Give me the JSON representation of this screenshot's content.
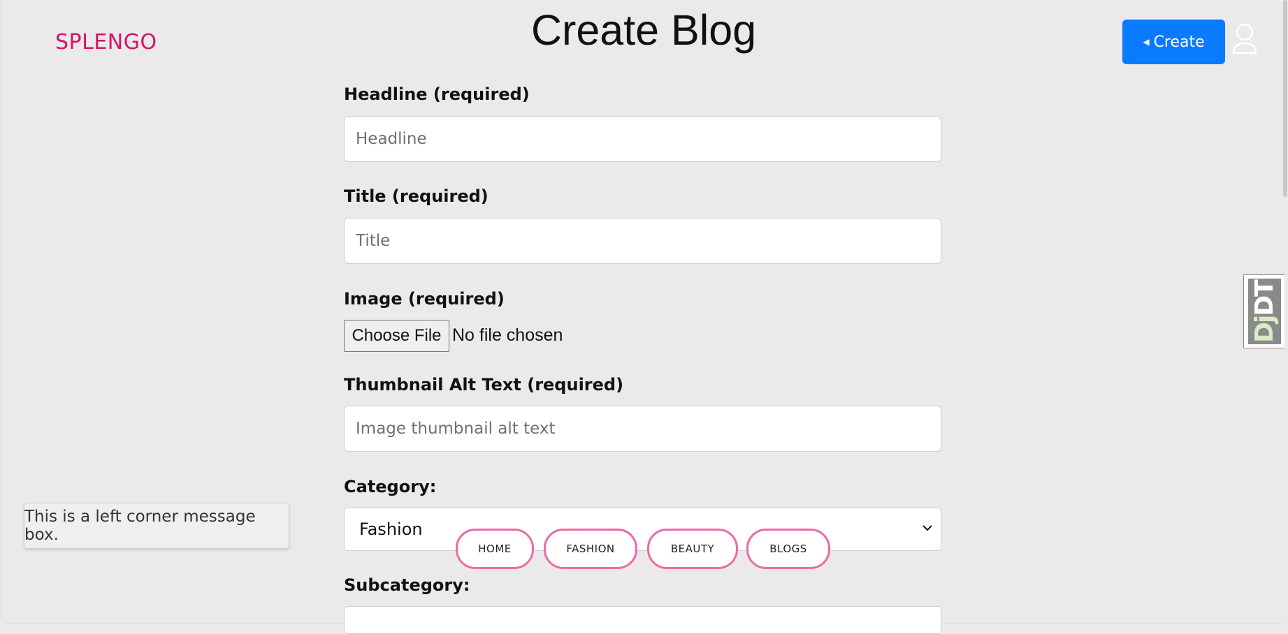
{
  "header": {
    "brand": "SPLENGO",
    "title": "Create Blog",
    "create_label": "Create",
    "avatar_icon": "user-icon"
  },
  "form": {
    "headline": {
      "label": "Headline (required)",
      "placeholder": "Headline",
      "value": ""
    },
    "title": {
      "label": "Title (required)",
      "placeholder": "Title",
      "value": ""
    },
    "image": {
      "label": "Image (required)",
      "button": "Choose File",
      "status": "No file chosen"
    },
    "alt_text": {
      "label": "Thumbnail Alt Text (required)",
      "placeholder": "Image thumbnail alt text",
      "value": ""
    },
    "category": {
      "label": "Category:",
      "selected": "Fashion"
    },
    "subcategory": {
      "label": "Subcategory:",
      "selected": ""
    }
  },
  "pill_nav": [
    "HOME",
    "FASHION",
    "BEAUTY",
    "BLOGS"
  ],
  "message_box": "This is a left corner message box.",
  "debug_toolbar": {
    "label_dj": "Dj",
    "label_dt": "DT"
  },
  "colors": {
    "brand": "#d01568",
    "primary_button": "#0a7bff",
    "pill_border": "#ee6aa7",
    "page_bg": "#ebe9ea"
  }
}
